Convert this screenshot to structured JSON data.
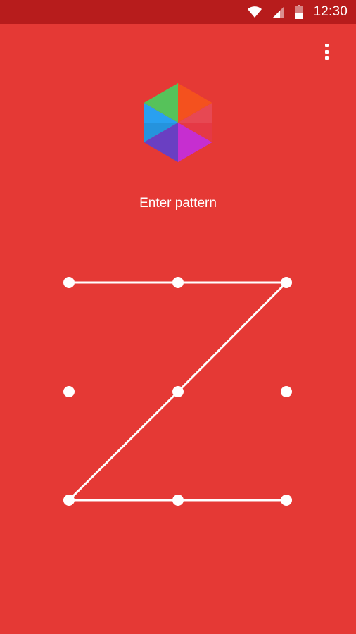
{
  "status_bar": {
    "time": "12:30",
    "icons": [
      "wifi-icon",
      "cell-signal-icon",
      "battery-icon"
    ]
  },
  "menu": {
    "icon": "overflow-menu-icon"
  },
  "app": {
    "logo": "hexagon-logo"
  },
  "lock_screen": {
    "prompt": "Enter pattern",
    "grid": {
      "rows": 3,
      "cols": 3
    },
    "pattern_sequence": [
      1,
      2,
      3,
      5,
      7,
      8,
      9
    ]
  },
  "colors": {
    "background": "#e53935",
    "status_bar": "#b71c1c",
    "foreground": "#ffffff"
  }
}
